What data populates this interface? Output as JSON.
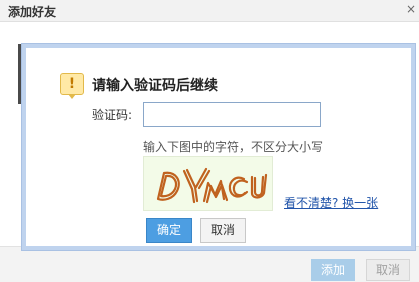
{
  "window": {
    "title": "添加好友",
    "close_glyph": "×"
  },
  "footer": {
    "add_label": "添加",
    "cancel_label": "取消"
  },
  "captcha": {
    "heading": "请输入验证码后继续",
    "warning_icon_glyph": "!",
    "code_label": "验证码:",
    "code_value": "",
    "hint": "输入下图中的字符，不区分大小写",
    "refresh_link": "看不清楚? 换一张",
    "ok_label": "确定",
    "cancel_label": "取消"
  },
  "colors": {
    "dialog_border": "#bfd3ee",
    "primary_button": "#4d9ee2",
    "link": "#2255aa",
    "captcha_bg": "#f3fbe8",
    "captcha_strokes": "#c0621f"
  }
}
